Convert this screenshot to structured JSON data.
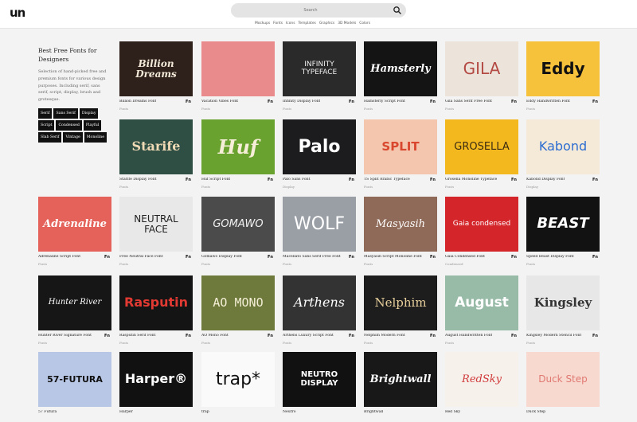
{
  "header": {
    "logo": "un",
    "search_placeholder": "Search",
    "nav": [
      "Mockups",
      "Fonts",
      "Icons",
      "Templates",
      "Graphics",
      "3D Models",
      "Colors"
    ]
  },
  "sidebar": {
    "title": "Best Free Fonts for Designers",
    "description": "Selection of hand-picked free and premium fonts for various design purposes. Including serif, sans serif, script, display, brush and grotesque.",
    "tags": [
      "Serif",
      "Sans Serif",
      "Display",
      "Script",
      "Condensed",
      "Playful",
      "Slab Serif",
      "Vintage",
      "Monoline"
    ]
  },
  "cards": [
    {
      "name": "Billion Dreams Font",
      "cat": "Fonts",
      "fn": "Fn",
      "art": "Billion Dreams",
      "bg": "#2e211b",
      "fg": "#f3ead9",
      "font": "DejaVu Serif",
      "style": "italic",
      "weight": "bold",
      "size": 12
    },
    {
      "name": "Vacation Vibes Font",
      "cat": "Fonts",
      "fn": "Fn",
      "art": "",
      "bg": "#e98a8c",
      "fg": "#333",
      "font": "DejaVu Sans",
      "style": "normal",
      "weight": "bold",
      "size": 8
    },
    {
      "name": "Infinity Display Font",
      "cat": "Fonts",
      "fn": "Fn",
      "art": "INFINITY TYPEFACE",
      "bg": "#2a2a2a",
      "fg": "#eee",
      "font": "DejaVu Sans",
      "style": "normal",
      "weight": "normal",
      "size": 9
    },
    {
      "name": "Hamsterly Script Font",
      "cat": "Fonts",
      "fn": "Fn",
      "art": "Hamsterly",
      "bg": "#141414",
      "fg": "#fff",
      "font": "DejaVu Serif",
      "style": "italic",
      "weight": "bold",
      "size": 13
    },
    {
      "name": "Gila Sans Serif Free Font",
      "cat": "Fonts",
      "fn": "Fn",
      "art": "GILA",
      "bg": "#ece4db",
      "fg": "#b44a44",
      "font": "DejaVu Sans",
      "style": "normal",
      "weight": "normal",
      "size": 20
    },
    {
      "name": "Eddy Handwritten Font",
      "cat": "Fonts",
      "fn": "Fn",
      "art": "Eddy",
      "bg": "#f6c13b",
      "fg": "#111",
      "font": "DejaVu Sans",
      "style": "normal",
      "weight": "bold",
      "size": 20
    },
    {
      "name": "Starife Display Font",
      "cat": "Fonts",
      "fn": "Fn",
      "art": "Starife",
      "bg": "#2f4e44",
      "fg": "#f0d9b5",
      "font": "DejaVu Serif",
      "style": "normal",
      "weight": "bold",
      "size": 16
    },
    {
      "name": "Huf Script Font",
      "cat": "Fonts",
      "fn": "Fn",
      "art": "Huf",
      "bg": "#6aa22f",
      "fg": "#f6eed8",
      "font": "DejaVu Serif",
      "style": "italic",
      "weight": "bold",
      "size": 24
    },
    {
      "name": "Palo Sans Font",
      "cat": "Display",
      "fn": "Fn",
      "art": "Palo",
      "bg": "#1c1c1f",
      "fg": "#fff",
      "font": "DejaVu Sans",
      "style": "normal",
      "weight": "bold",
      "size": 22
    },
    {
      "name": "TS Split Arabic Typeface",
      "cat": "Fonts",
      "fn": "Fn",
      "art": "SPLIT",
      "bg": "#f3c6ad",
      "fg": "#d9472f",
      "font": "DejaVu Sans",
      "style": "normal",
      "weight": "bold",
      "size": 15
    },
    {
      "name": "Grosella Monoline Typeface",
      "cat": "Fonts",
      "fn": "Fn",
      "art": "GROSELLA",
      "bg": "#f2b81e",
      "fg": "#3d2c12",
      "font": "DejaVu Sans",
      "style": "normal",
      "weight": "normal",
      "size": 13
    },
    {
      "name": "Kabond Display Font",
      "cat": "Display",
      "fn": "Fn",
      "art": "Kabond",
      "bg": "#f5ead7",
      "fg": "#2c6dd1",
      "font": "DejaVu Sans",
      "style": "normal",
      "weight": "normal",
      "size": 16
    },
    {
      "name": "Adrenaline Script Font",
      "cat": "Fonts",
      "fn": "Fn",
      "art": "Adrenaline",
      "bg": "#e4625a",
      "fg": "#fff",
      "font": "DejaVu Serif",
      "style": "italic",
      "weight": "bold",
      "size": 13
    },
    {
      "name": "Free Neutral Face Font",
      "cat": "Fonts",
      "fn": "Fn",
      "art": "NEUTRAL FACE",
      "bg": "#e8e8e8",
      "fg": "#222",
      "font": "DejaVu Sans",
      "style": "normal",
      "weight": "normal",
      "size": 12
    },
    {
      "name": "Gomawo Display Font",
      "cat": "Fonts",
      "fn": "Fn",
      "art": "GOMAWO",
      "bg": "#4b4b4b",
      "fg": "#f2f2f2",
      "font": "DejaVu Sans",
      "style": "italic",
      "weight": "normal",
      "size": 13
    },
    {
      "name": "Macellato Sans Serif Free Font",
      "cat": "Fonts",
      "fn": "Fn",
      "art": "WOLF",
      "bg": "#9a9fa6",
      "fg": "#fff",
      "font": "DejaVu Sans",
      "style": "normal",
      "weight": "normal",
      "size": 22
    },
    {
      "name": "Masyasih Script Monoline Font",
      "cat": "Fonts",
      "fn": "Fn",
      "art": "Masyasih",
      "bg": "#8f6a58",
      "fg": "#fff",
      "font": "DejaVu Serif",
      "style": "italic",
      "weight": "normal",
      "size": 13
    },
    {
      "name": "Gaia Condensed Font",
      "cat": "Condensed",
      "fn": "Fn",
      "art": "Gaia condensed",
      "bg": "#d4252b",
      "fg": "#fff",
      "font": "DejaVu Sans",
      "style": "normal",
      "weight": "normal",
      "size": 9
    },
    {
      "name": "Speed Beast Display Font",
      "cat": "Fonts",
      "fn": "Fn",
      "art": "BEAST",
      "bg": "#121212",
      "fg": "#fff",
      "font": "DejaVu Sans",
      "style": "italic",
      "weight": "bold",
      "size": 18
    },
    {
      "name": "Hunter River Signature Font",
      "cat": "Fonts",
      "fn": "Fn",
      "art": "Hunter River",
      "bg": "#161616",
      "fg": "#fff",
      "font": "DejaVu Serif",
      "style": "italic",
      "weight": "normal",
      "size": 10
    },
    {
      "name": "Rasputin Serif Font",
      "cat": "Fonts",
      "fn": "Fn",
      "art": "Rasputin",
      "bg": "#141414",
      "fg": "#e23a32",
      "font": "DejaVu Sans",
      "style": "normal",
      "weight": "bold",
      "size": 16
    },
    {
      "name": "AO Mono Font",
      "cat": "Fonts",
      "fn": "Fn",
      "art": "AO MONO",
      "bg": "#6d7a3c",
      "fg": "#f4eed6",
      "font": "DejaVu Sans Mono",
      "style": "normal",
      "weight": "normal",
      "size": 15
    },
    {
      "name": "Arthens Luxury Script Font",
      "cat": "Fonts",
      "fn": "Fn",
      "art": "Arthens",
      "bg": "#333",
      "fg": "#fff",
      "font": "DejaVu Serif",
      "style": "italic",
      "weight": "normal",
      "size": 16
    },
    {
      "name": "Nelphim Modern Font",
      "cat": "Fonts",
      "fn": "Fn",
      "art": "Nelphim",
      "bg": "#1d1d1d",
      "fg": "#e7cf9b",
      "font": "DejaVu Serif",
      "style": "normal",
      "weight": "normal",
      "size": 15
    },
    {
      "name": "August Handwritten Font",
      "cat": "Fonts",
      "fn": "Fn",
      "art": "August",
      "bg": "#98bba8",
      "fg": "#fff",
      "font": "DejaVu Sans",
      "style": "normal",
      "weight": "bold",
      "size": 17
    },
    {
      "name": "Kingsley Modern Stencil Font",
      "cat": "Fonts",
      "fn": "Fn",
      "art": "Kingsley",
      "bg": "#e7e7e7",
      "fg": "#333",
      "font": "DejaVu Serif",
      "style": "normal",
      "weight": "bold",
      "size": 15
    },
    {
      "name": "57 Futura",
      "cat": "",
      "fn": "",
      "art": "57-FUTURA",
      "bg": "#b9c7e6",
      "fg": "#111",
      "font": "DejaVu Sans",
      "style": "normal",
      "weight": "bold",
      "size": 11
    },
    {
      "name": "Harper",
      "cat": "",
      "fn": "",
      "art": "Harper®",
      "bg": "#111",
      "fg": "#fff",
      "font": "DejaVu Sans",
      "style": "normal",
      "weight": "bold",
      "size": 16
    },
    {
      "name": "trap",
      "cat": "",
      "fn": "",
      "art": "trap*",
      "bg": "#fafafa",
      "fg": "#111",
      "font": "DejaVu Sans",
      "style": "normal",
      "weight": "normal",
      "size": 22
    },
    {
      "name": "Neutro",
      "cat": "",
      "fn": "",
      "art": "NEUTRO DISPLAY",
      "bg": "#111",
      "fg": "#fff",
      "font": "DejaVu Sans",
      "style": "normal",
      "weight": "bold",
      "size": 10
    },
    {
      "name": "Brightwall",
      "cat": "",
      "fn": "",
      "art": "Brightwall",
      "bg": "#181818",
      "fg": "#fff",
      "font": "DejaVu Serif",
      "style": "italic",
      "weight": "bold",
      "size": 13
    },
    {
      "name": "Red Sky",
      "cat": "",
      "fn": "",
      "art": "RedSky",
      "bg": "#f7f1ec",
      "fg": "#d03a3a",
      "font": "DejaVu Serif",
      "style": "italic",
      "weight": "normal",
      "size": 13
    },
    {
      "name": "Duck Step",
      "cat": "",
      "fn": "",
      "art": "Duck Step",
      "bg": "#f7d9cf",
      "fg": "#e07a73",
      "font": "DejaVu Sans",
      "style": "normal",
      "weight": "normal",
      "size": 12
    }
  ],
  "colors": {
    "accent": "#111111",
    "page_bg": "#f3f3f3"
  }
}
